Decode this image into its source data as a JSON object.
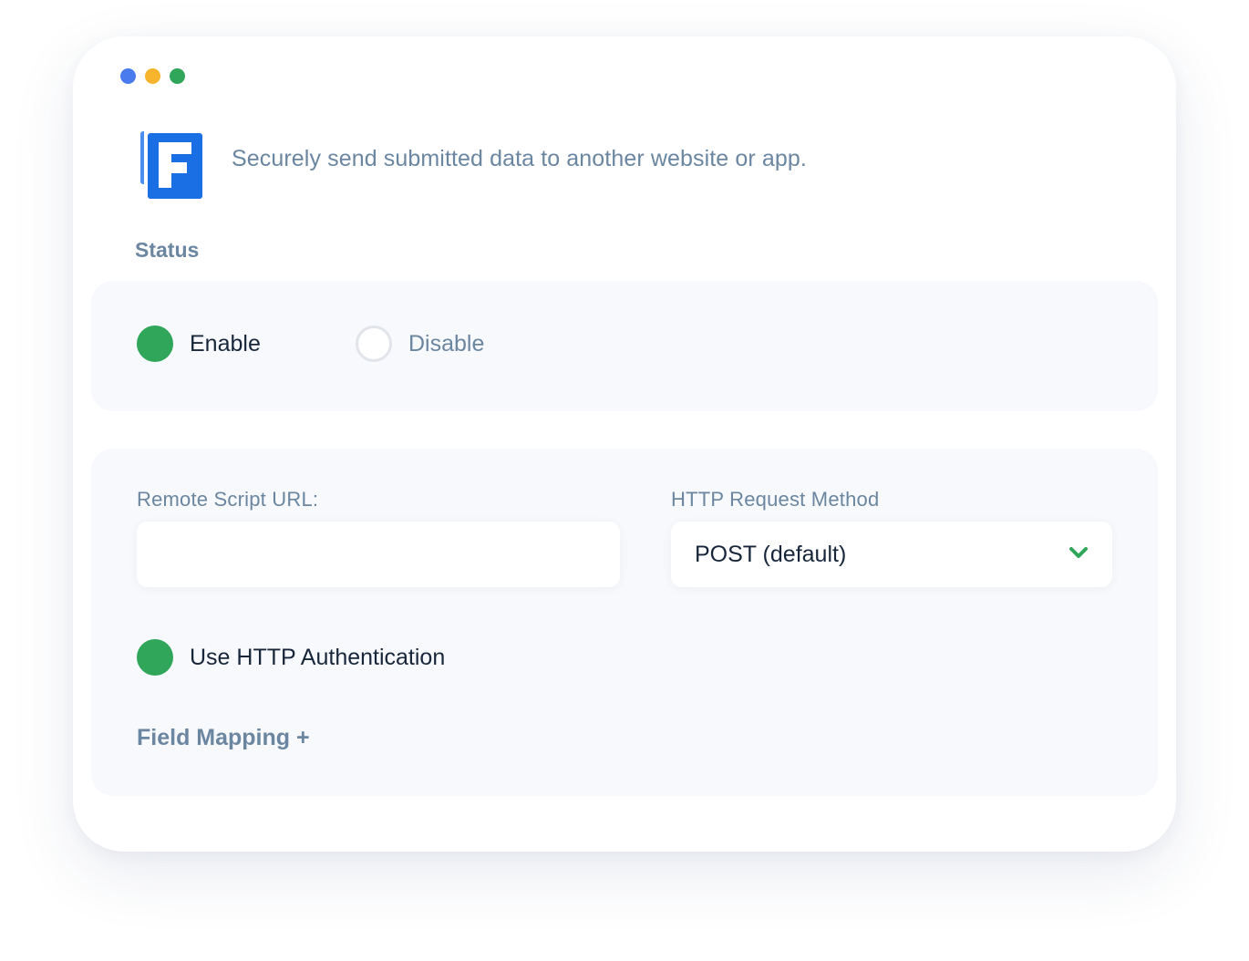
{
  "window": {
    "dots": [
      "blue",
      "yellow",
      "green"
    ]
  },
  "header": {
    "logo_icon": "formidable-f-logo",
    "description": "Securely send submitted data to another website or app."
  },
  "status": {
    "title": "Status",
    "options": [
      {
        "label": "Enable",
        "selected": true
      },
      {
        "label": "Disable",
        "selected": false
      }
    ]
  },
  "settings": {
    "remote_url": {
      "label": "Remote Script URL:",
      "value": "",
      "placeholder": ""
    },
    "http_method": {
      "label": "HTTP Request Method",
      "value": "POST (default)",
      "icon": "chevron-down-icon"
    },
    "http_auth": {
      "label": "Use HTTP Authentication",
      "checked": true
    },
    "field_mapping": {
      "label": "Field Mapping +"
    }
  },
  "colors": {
    "accent_green": "#2fa65a",
    "logo_blue": "#1a6fe5",
    "dot_blue": "#4a7bee",
    "dot_yellow": "#f6b52d",
    "dot_green": "#2fa65a",
    "muted_text": "#6a86a1",
    "dark_text": "#17263a",
    "panel_bg": "#f8f9fc"
  }
}
